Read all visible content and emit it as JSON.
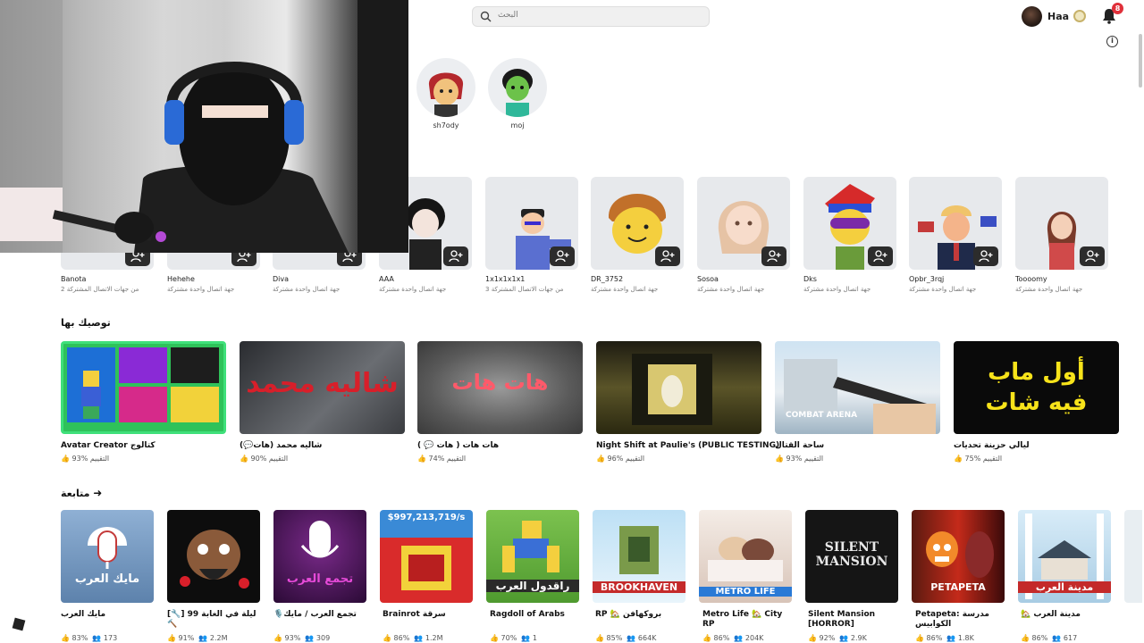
{
  "header": {
    "search_placeholder": "البحث",
    "username": "Haa",
    "notification_count": "8"
  },
  "online_friends": [
    {
      "name": "sh7ody",
      "color": "#b4282d"
    },
    {
      "name": "moj",
      "color": "#6cc24a"
    }
  ],
  "friends": [
    {
      "name": "Banota",
      "sub": "2 من جهات الاتصال المشتركة"
    },
    {
      "name": "Hehehe",
      "sub": "جهة اتصال واحدة مشتركة"
    },
    {
      "name": "Diva",
      "sub": "جهة اتصال واحدة مشتركة"
    },
    {
      "name": "AAA",
      "sub": "جهة اتصال واحدة مشتركة"
    },
    {
      "name": "1x1x1x1x1",
      "sub": "3 من جهات الاتصال المشتركة"
    },
    {
      "name": "DR_3752",
      "sub": "جهة اتصال واحدة مشتركة"
    },
    {
      "name": "Sosoa",
      "sub": "جهة اتصال واحدة مشتركة"
    },
    {
      "name": "Dks",
      "sub": "جهة اتصال واحدة مشتركة"
    },
    {
      "name": "Opbr_3rqj",
      "sub": "جهة اتصال واحدة مشتركة"
    },
    {
      "name": "Toooomy",
      "sub": "جهة اتصال واحدة مشتركة"
    }
  ],
  "recommended": {
    "title": "توصيك بها",
    "rating_label": "التقييم",
    "items": [
      {
        "title": "Avatar Creator كتالوج",
        "rating": "93%",
        "bg": "#1e7a2e",
        "overlay": ""
      },
      {
        "title": "شاليه محمد (هات💬)",
        "rating": "90%",
        "bg": "#4a4d52",
        "overlay": "شاليه محمد"
      },
      {
        "title": "هات هات ( هات 💬 )",
        "rating": "74%",
        "bg": "#6a6a6a",
        "overlay": "هات هات"
      },
      {
        "title": "Night Shift at Paulie's (PUBLIC TESTING)",
        "rating": "96%",
        "bg": "#3c3a22",
        "overlay": ""
      },
      {
        "title": "ساحة القتال",
        "rating": "93%",
        "bg": "#8fb0c8",
        "overlay": "COMBAT ARENA"
      },
      {
        "title": "ليالي حزينة تحديات",
        "rating": "75%",
        "bg": "#0a0a0a",
        "overlay": "أول ماب فيه شات"
      }
    ]
  },
  "continue": {
    "title": "متابعة",
    "items": [
      {
        "title": "مايك العرب",
        "rating": "83%",
        "players": "173",
        "bg": "#6d8fb5",
        "overlay": "مايك العرب"
      },
      {
        "title": "[🔧] 99 ليلة في الغابة 🔨",
        "rating": "91%",
        "players": "2.2M",
        "bg": "#0d0d0d",
        "overlay": ""
      },
      {
        "title": "🎙️تجمع العرب / مايك",
        "rating": "93%",
        "players": "309",
        "bg": "#3a0d45",
        "overlay": "تجمع العرب"
      },
      {
        "title": "Brainrot سرقة",
        "rating": "86%",
        "players": "1.2M",
        "bg": "#d92b2b",
        "overlay": "$997,213,719/s"
      },
      {
        "title": "Ragdoll of Arabs",
        "rating": "70%",
        "players": "1",
        "bg": "#7cc24f",
        "overlay": "راقدول العرب"
      },
      {
        "title": "RP 🏡 بروكهافن",
        "rating": "85%",
        "players": "664K",
        "bg": "#a8d4ef",
        "overlay": "BROOKHAVEN"
      },
      {
        "title": "Metro Life 🏡 City RP",
        "rating": "86%",
        "players": "204K",
        "bg": "#e9d9cf",
        "overlay": "METRO LIFE"
      },
      {
        "title": "Silent Mansion [HORROR]",
        "rating": "92%",
        "players": "2.9K",
        "bg": "#161616",
        "overlay": "SILENT MANSION"
      },
      {
        "title": "Petapeta: مدرسة الكوابيس",
        "rating": "86%",
        "players": "1.8K",
        "bg": "#3a0a0a",
        "overlay": "PETAPETA"
      },
      {
        "title": "🏡 مدينة العرب",
        "rating": "86%",
        "players": "617",
        "bg": "#cfe6f5",
        "overlay": "مدينة العرب"
      }
    ]
  },
  "colors": {
    "accent": "#e0303a",
    "dark_button": "#2c2c2c"
  },
  "icons": [
    "search-icon",
    "robux-icon",
    "bell-icon",
    "info-icon",
    "add-friend-icon",
    "thumbs-up-icon",
    "people-icon",
    "arrow-right-icon"
  ]
}
